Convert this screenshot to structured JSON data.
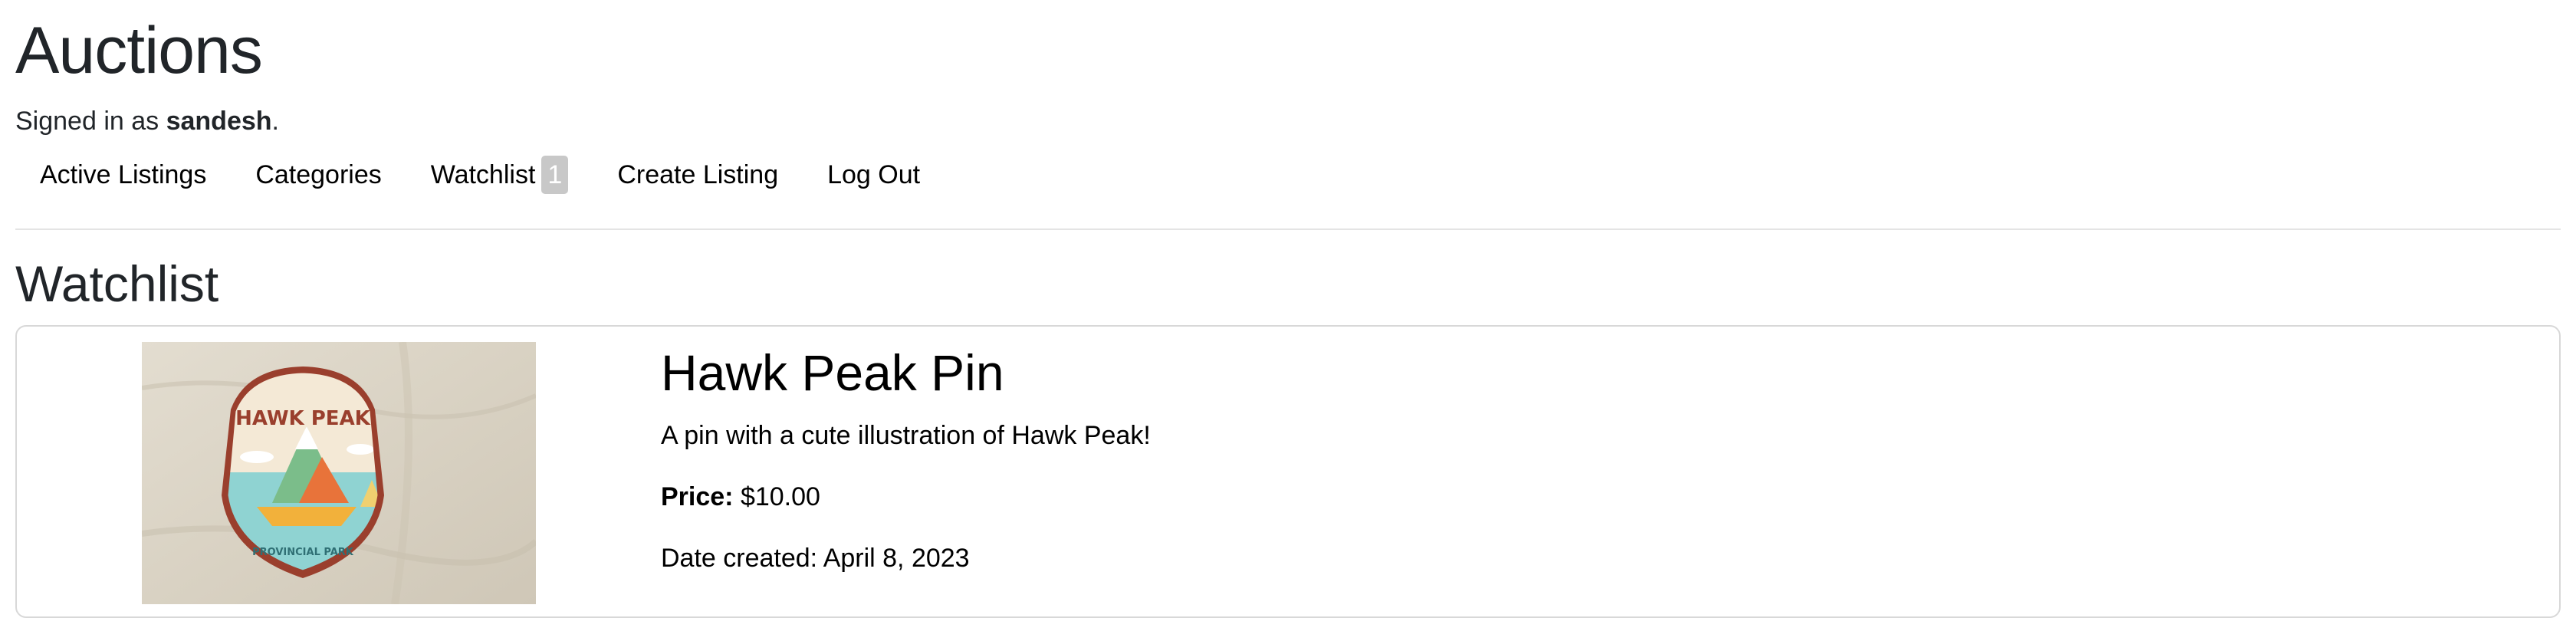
{
  "header": {
    "title": "Auctions",
    "signed_in_prefix": "Signed in as ",
    "username": "sandesh",
    "signed_in_suffix": "."
  },
  "nav": {
    "active_listings": "Active Listings",
    "categories": "Categories",
    "watchlist": "Watchlist",
    "watchlist_count": "1",
    "create_listing": "Create Listing",
    "log_out": "Log Out"
  },
  "main": {
    "section_title": "Watchlist",
    "listings": [
      {
        "title": "Hawk Peak Pin",
        "description": "A pin with a cute illustration of Hawk Peak!",
        "price_label": "Price:",
        "price_value": " $10.00",
        "date_label": "Date created: ",
        "date_value": "April 8, 2023",
        "image_alt": "Hawk Peak Provincial Park pin",
        "pin_text_top": "HAWK PEAK",
        "pin_text_bottom": "PROVINCIAL PARK"
      }
    ]
  },
  "colors": {
    "text": "#212529",
    "badge": "#c8c8c8",
    "border": "#d8d8d8",
    "divider": "#e4e4e4"
  }
}
